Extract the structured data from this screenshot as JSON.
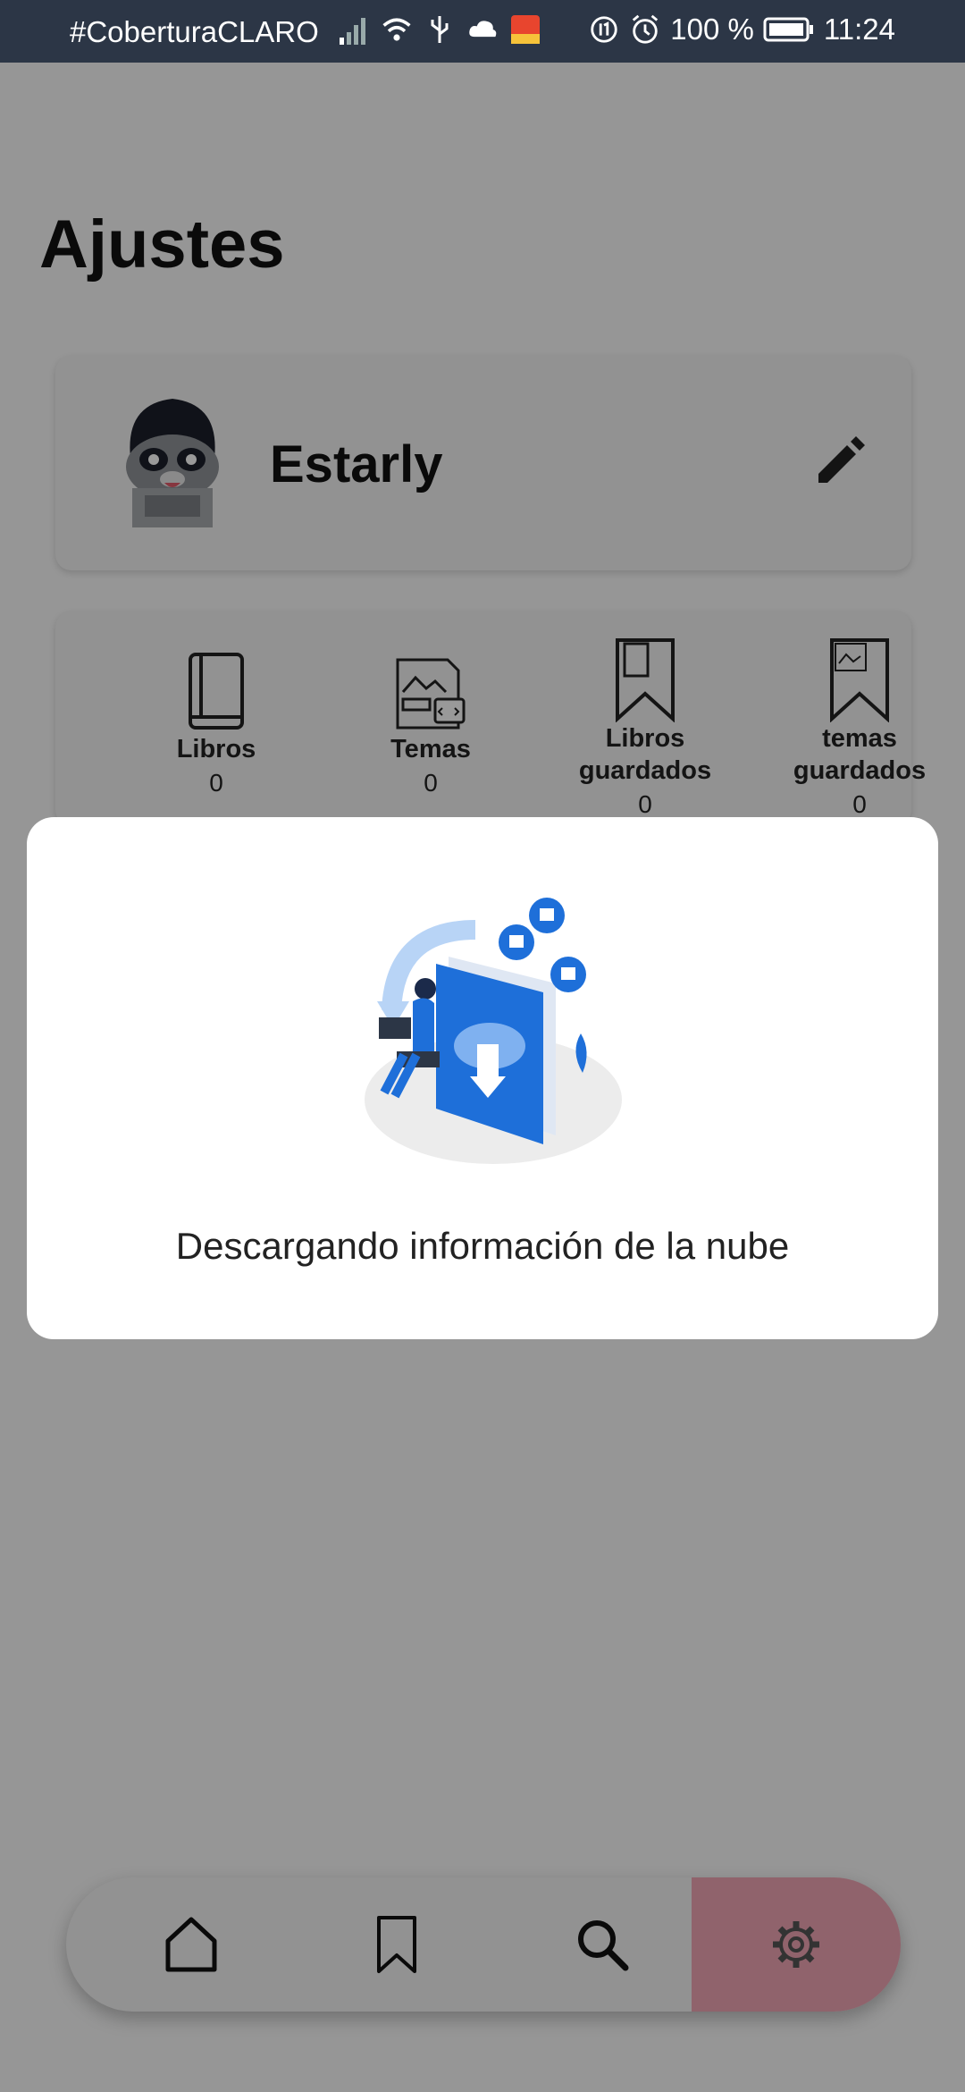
{
  "status_bar": {
    "carrier": "#CoberturaCLARO",
    "battery": "100 %",
    "time": "11:24"
  },
  "settings": {
    "title": "Ajustes"
  },
  "profile": {
    "name": "Estarly"
  },
  "stats": [
    {
      "label": "Libros",
      "count": "0"
    },
    {
      "label": "Temas",
      "count": "0"
    },
    {
      "label": "Libros guardados",
      "count": "0"
    },
    {
      "label": "temas guardados",
      "count": "0"
    }
  ],
  "dialog": {
    "message": "Descargando información de la nube"
  },
  "bottom_nav": {
    "items": [
      "home-icon",
      "bookmark-icon",
      "search-icon",
      "gear-icon"
    ],
    "active": "gear-icon",
    "active_color": "#f0a5b5"
  },
  "colors": {
    "status_bar_bg": "#2c3646",
    "accent_blue": "#1e6fd9"
  }
}
